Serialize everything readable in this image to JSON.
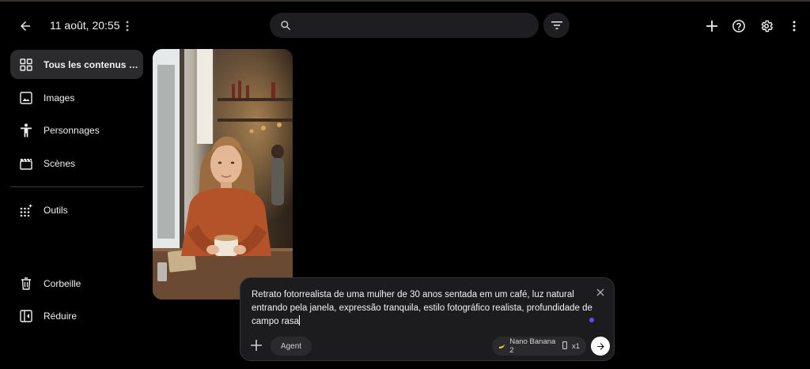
{
  "header": {
    "title": "11 août, 20:55",
    "search_placeholder": ""
  },
  "sidebar": {
    "items": [
      {
        "label": "Tous les contenus mul…",
        "icon": "grid-icon",
        "active": true
      },
      {
        "label": "Images",
        "icon": "image-icon"
      },
      {
        "label": "Personnages",
        "icon": "person-icon"
      },
      {
        "label": "Scènes",
        "icon": "clapperboard-icon"
      },
      {
        "label": "Outils",
        "icon": "tools-grid-icon"
      },
      {
        "label": "Corbeille",
        "icon": "trash-icon"
      },
      {
        "label": "Réduire",
        "icon": "collapse-icon"
      }
    ]
  },
  "composer": {
    "prompt": "Retrato fotorrealista de uma mulher de 30 anos sentada em um café, luz natural entrando pela janela, expressão tranquila, estilo fotográfico realista, profundidade de campo rasa",
    "agent_label": "Agent",
    "model_label": "Nano Banana 2",
    "count_label": "x1"
  },
  "colors": {
    "background": "#000000",
    "surface": "#1c1c1f",
    "accent_dot": "#6a4cf0"
  }
}
